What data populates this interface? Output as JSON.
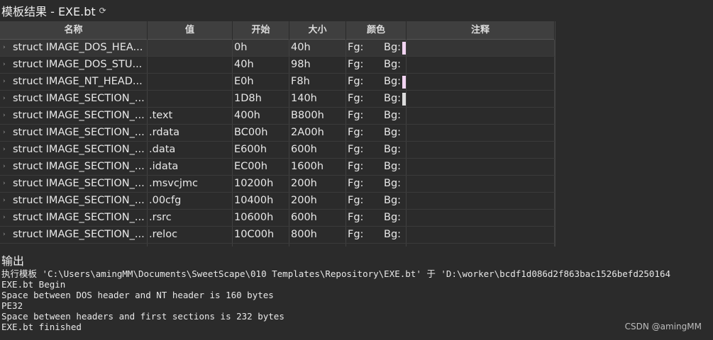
{
  "title": "模板结果 - EXE.bt",
  "refresh_icon": "refresh-icon",
  "table": {
    "headers": [
      "名称",
      "值",
      "开始",
      "大小",
      "颜色",
      "注释"
    ],
    "rows": [
      {
        "name": "struct IMAGE_DOS_HEA...",
        "value": "",
        "start": "0h",
        "size": "40h",
        "fg": "Fg:",
        "bg": "Bg:",
        "bg_swatch": "#f2d4f2"
      },
      {
        "name": "struct IMAGE_DOS_STU...",
        "value": "",
        "start": "40h",
        "size": "98h",
        "fg": "Fg:",
        "bg": "Bg:",
        "bg_swatch": ""
      },
      {
        "name": "struct IMAGE_NT_HEAD...",
        "value": "",
        "start": "E0h",
        "size": "F8h",
        "fg": "Fg:",
        "bg": "Bg:",
        "bg_swatch": "#f2d4f2"
      },
      {
        "name": "struct IMAGE_SECTION_...",
        "value": "",
        "start": "1D8h",
        "size": "140h",
        "fg": "Fg:",
        "bg": "Bg:",
        "bg_swatch": "#dcdcdc"
      },
      {
        "name": "struct IMAGE_SECTION_...",
        "value": ".text",
        "start": "400h",
        "size": "B800h",
        "fg": "Fg:",
        "bg": "Bg:",
        "bg_swatch": ""
      },
      {
        "name": "struct IMAGE_SECTION_...",
        "value": ".rdata",
        "start": "BC00h",
        "size": "2A00h",
        "fg": "Fg:",
        "bg": "Bg:",
        "bg_swatch": ""
      },
      {
        "name": "struct IMAGE_SECTION_...",
        "value": ".data",
        "start": "E600h",
        "size": "600h",
        "fg": "Fg:",
        "bg": "Bg:",
        "bg_swatch": ""
      },
      {
        "name": "struct IMAGE_SECTION_...",
        "value": ".idata",
        "start": "EC00h",
        "size": "1600h",
        "fg": "Fg:",
        "bg": "Bg:",
        "bg_swatch": ""
      },
      {
        "name": "struct IMAGE_SECTION_...",
        "value": ".msvcjmc",
        "start": "10200h",
        "size": "200h",
        "fg": "Fg:",
        "bg": "Bg:",
        "bg_swatch": ""
      },
      {
        "name": "struct IMAGE_SECTION_...",
        "value": ".00cfg",
        "start": "10400h",
        "size": "200h",
        "fg": "Fg:",
        "bg": "Bg:",
        "bg_swatch": ""
      },
      {
        "name": "struct IMAGE_SECTION_...",
        "value": ".rsrc",
        "start": "10600h",
        "size": "600h",
        "fg": "Fg:",
        "bg": "Bg:",
        "bg_swatch": ""
      },
      {
        "name": "struct IMAGE_SECTION_...",
        "value": ".reloc",
        "start": "10C00h",
        "size": "800h",
        "fg": "Fg:",
        "bg": "Bg:",
        "bg_swatch": ""
      },
      {
        "name": "",
        "value": "",
        "start": "",
        "size": "",
        "fg": "",
        "bg": "",
        "bg_swatch": ""
      }
    ]
  },
  "output": {
    "title": "输出",
    "lines": [
      "执行模板 'C:\\Users\\amingMM\\Documents\\SweetScape\\010 Templates\\Repository\\EXE.bt' 于 'D:\\worker\\bcdf1d086d2f863bac1526befd250164",
      "EXE.bt Begin",
      "Space between DOS header and NT header is 160 bytes",
      "PE32",
      "Space between headers and first sections is 232 bytes",
      "EXE.bt finished"
    ]
  },
  "watermark": "CSDN @amingMM"
}
